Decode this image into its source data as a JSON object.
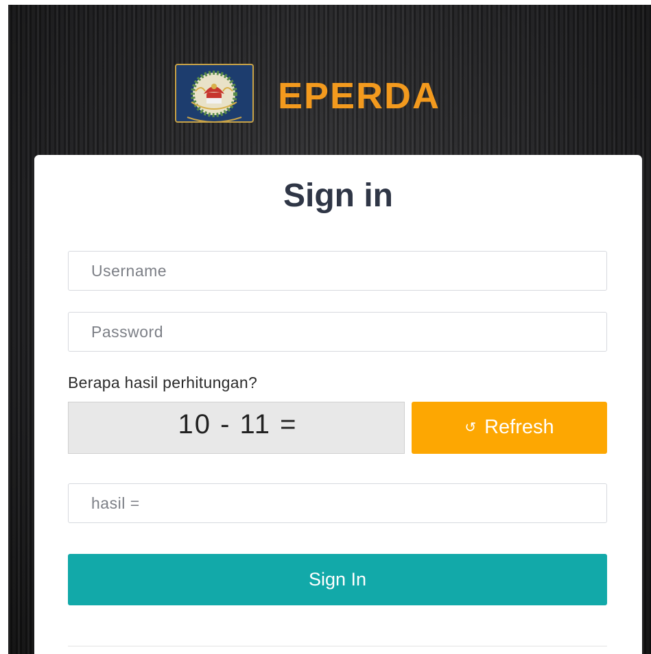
{
  "brand": {
    "name": "EPERDA",
    "logo_icon": "garuda-emblem-icon"
  },
  "form": {
    "title": "Sign in",
    "username_placeholder": "Username",
    "password_placeholder": "Password",
    "captcha_question": "Berapa hasil perhitungan?",
    "captcha_expression": "10 - 11 =",
    "refresh_icon": "refresh-icon",
    "refresh_glyph": "↺",
    "refresh_label": "Refresh",
    "answer_placeholder": "hasil =",
    "submit_label": "Sign In"
  },
  "colors": {
    "brand_orange": "#f39a1e",
    "refresh_button": "#fda702",
    "submit_button": "#12a9a9",
    "title_text": "#2f3646",
    "captcha_bg": "#e8e8e8"
  }
}
